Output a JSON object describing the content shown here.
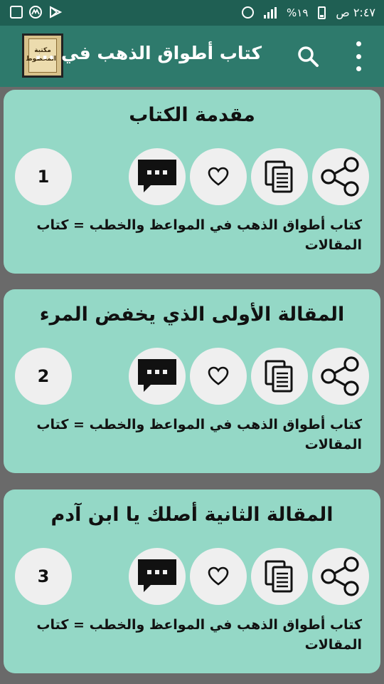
{
  "status_bar": {
    "time": "٢:٤٧ ص",
    "battery_percent": "%١٩",
    "icons_right": [
      "alarm-icon",
      "signal-icon",
      "battery-icon"
    ],
    "icons_left": [
      "play-store-icon",
      "app-notification-icon",
      "gallery-icon"
    ]
  },
  "app_bar": {
    "title": "كتاب أطواق الذهب في ...",
    "logo_text": "مكتبة المخطوط",
    "icons": [
      "more-options-icon",
      "search-icon"
    ]
  },
  "colors": {
    "status_bar": "#1f5f53",
    "app_bar": "#2e7a6c",
    "card": "#94d8c6",
    "circle": "#efefef",
    "background": "#6a6a6a"
  },
  "cards": [
    {
      "title": "مقدمة الكتاب",
      "number": "1",
      "description": "كتاب أطواق الذهب في المواعظ والخطب = كتاب المقالات"
    },
    {
      "title": "المقالة الأولى الذي يخفض المرء",
      "number": "2",
      "description": "كتاب أطواق الذهب في المواعظ والخطب = كتاب المقالات"
    },
    {
      "title": "المقالة الثانية أصلك يا ابن آدم",
      "number": "3",
      "description": "كتاب أطواق الذهب في المواعظ والخطب = كتاب المقالات"
    }
  ]
}
